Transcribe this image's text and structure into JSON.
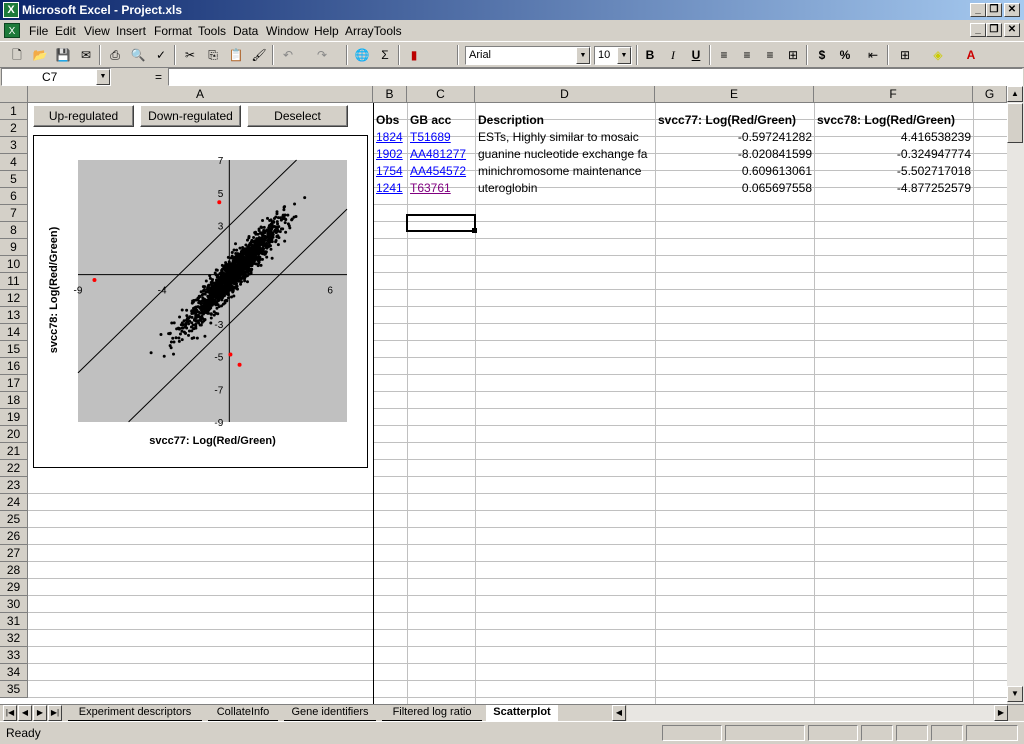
{
  "window": {
    "title": "Microsoft Excel - Project.xls",
    "app_icon": "X"
  },
  "menu": [
    "File",
    "Edit",
    "View",
    "Insert",
    "Format",
    "Tools",
    "Data",
    "Window",
    "Help",
    "ArrayTools"
  ],
  "menu_mnemonics": [
    "F",
    "E",
    "V",
    "I",
    "o",
    "T",
    "D",
    "W",
    "H",
    "A"
  ],
  "toolbar": {
    "font": "Arial",
    "size": "10",
    "bold": "B",
    "italic": "I",
    "underline": "U",
    "currency": "$",
    "percent": "%",
    "sum": "Σ"
  },
  "formula": {
    "name_box": "C7",
    "eq": "=",
    "value": ""
  },
  "columns": [
    {
      "label": "A"
    },
    {
      "label": "B"
    },
    {
      "label": "C"
    },
    {
      "label": "D"
    },
    {
      "label": "E"
    },
    {
      "label": "F"
    },
    {
      "label": "G"
    }
  ],
  "rows": [
    "1",
    "2",
    "3",
    "4",
    "5",
    "6",
    "7",
    "8",
    "9",
    "10",
    "11",
    "12",
    "13",
    "14",
    "15",
    "16",
    "17",
    "18",
    "19",
    "20",
    "21",
    "22",
    "23",
    "24",
    "25",
    "26",
    "27",
    "28",
    "29",
    "30",
    "31",
    "32",
    "33",
    "34",
    "35"
  ],
  "buttons": {
    "up": "Up-regulated",
    "down": "Down-regulated",
    "deselect": "Deselect"
  },
  "table": {
    "headers": [
      "Obs",
      "GB acc",
      "Description",
      "svcc77: Log(Red/Green)",
      "svcc78: Log(Red/Green)"
    ],
    "rows": [
      {
        "obs": "1824",
        "gb": "T51689",
        "desc": "ESTs, Highly similar to mosaic",
        "e": "-0.597241282",
        "f": "4.416538239"
      },
      {
        "obs": "1902",
        "gb": "AA481277",
        "desc": "guanine nucleotide exchange fa",
        "e": "-8.020841599",
        "f": "-0.324947774"
      },
      {
        "obs": "1754",
        "gb": "AA454572",
        "desc": "minichromosome maintenance",
        "e": "0.609613061",
        "f": "-5.502717018"
      },
      {
        "obs": "1241",
        "gb": "T63761",
        "desc": "uteroglobin",
        "e": "0.065697558",
        "f": "-4.877252579"
      }
    ]
  },
  "chart_data": {
    "type": "scatter",
    "xlabel": "svcc77: Log(Red/Green)",
    "ylabel": "svcc78: Log(Red/Green)",
    "xlim": [
      -9,
      7
    ],
    "ylim": [
      -9,
      7
    ],
    "x_ticks": [
      "-9",
      "-4",
      "6"
    ],
    "y_ticks": [
      "7",
      "5",
      "3",
      "-3",
      "-5",
      "-7",
      "-9"
    ],
    "reference_lines": [
      "y = x + 3",
      "y = x - 3"
    ],
    "highlighted_points": [
      {
        "x": -0.597,
        "y": 4.417
      },
      {
        "x": -8.021,
        "y": -0.325
      },
      {
        "x": 0.61,
        "y": -5.503
      },
      {
        "x": 0.066,
        "y": -4.877
      }
    ],
    "colors": {
      "points": "#000000",
      "highlighted": "#ff0000",
      "plot_bg": "#c0c0c0",
      "lines": "#000000"
    }
  },
  "sheet_tabs": [
    "Experiment descriptors",
    "CollateInfo",
    "Gene identifiers",
    "Filtered log ratio",
    "Scatterplot"
  ],
  "active_tab": "Scatterplot",
  "status": "Ready"
}
